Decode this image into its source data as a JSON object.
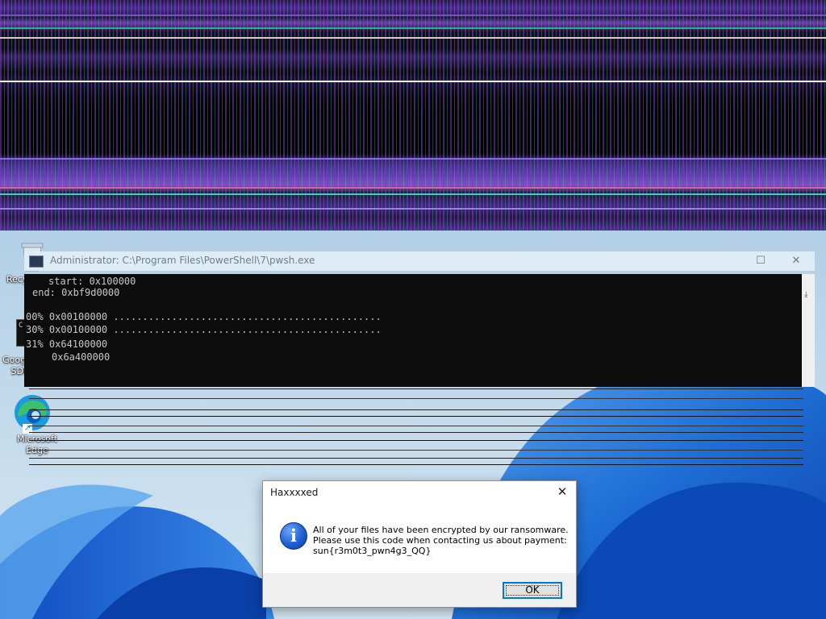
{
  "desktop": {
    "icons": [
      {
        "label": "Recycle Bin",
        "icon": "recycle-bin-icon"
      },
      {
        "label": "Google Cloud SDK Shell",
        "icon": "terminal-icon"
      },
      {
        "label": "Microsoft Edge",
        "icon": "edge-icon"
      }
    ]
  },
  "powershell": {
    "title": "Administrator: C:\\Program Files\\PowerShell\\7\\pwsh.exe",
    "lines": [
      "start: 0x100000",
      "end: 0xbf9d0000",
      "00% 0x00100000 ..............................................",
      "30% 0x00100000 ..............................................",
      "31% 0x64100000",
      "0x6a400000"
    ]
  },
  "dialog": {
    "title": "Haxxxxed",
    "line1": "All of your files have been encrypted by our ransomware.",
    "line2": "Please use this code when contacting us about payment:",
    "line3": "sun{r3m0t3_pwn4g3_QQ}",
    "ok_label": "OK",
    "icon": "info-icon"
  },
  "colors": {
    "accent": "#0078d7",
    "wallpaper_blue": "#1f6fd6"
  }
}
